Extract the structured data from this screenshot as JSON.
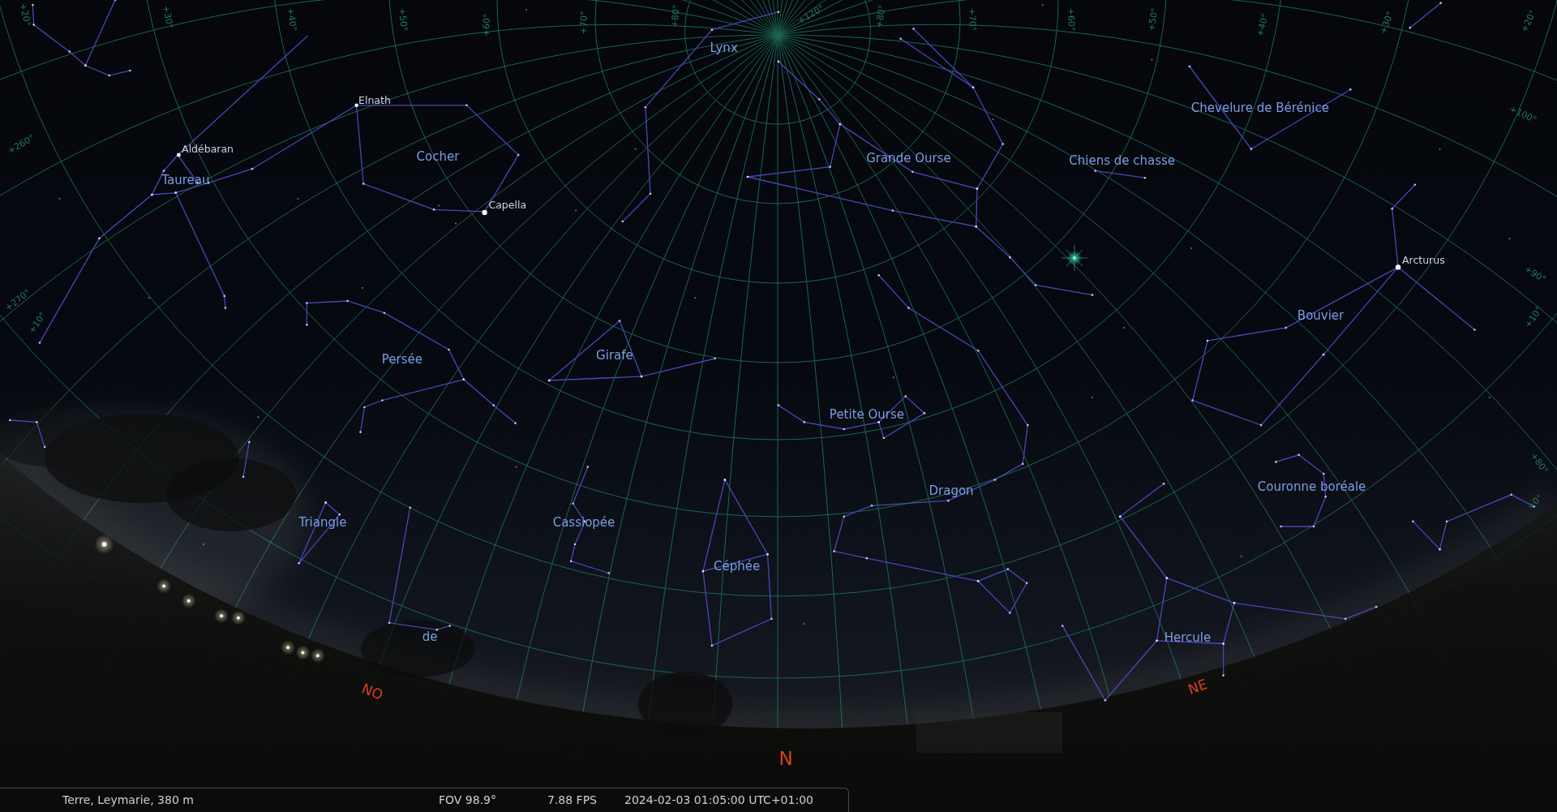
{
  "sky": {
    "grid_labels": [
      "+20°",
      "+30°",
      "+40°",
      "+50°",
      "+60°",
      "+70°",
      "+80°",
      "+120°",
      "+80°",
      "+70°",
      "+60°",
      "+50°",
      "+40°",
      "+30°",
      "+20°",
      "+100°",
      "+260°",
      "+90°",
      "+270°",
      "+10°",
      "+10°",
      "+80°",
      "+0°"
    ],
    "constellations": [
      "Lynx",
      "Chevelure de Bérénice",
      "Cocher",
      "Grande Ourse",
      "Chiens de chasse",
      "Taureau",
      "Bouvier",
      "Girafe",
      "Persée",
      "Petite Ourse",
      "Couronne boréale",
      "Dragon",
      "Triangle",
      "Cassiopée",
      "Céphée",
      "de",
      "Hercule"
    ],
    "stars": [
      "Elnath",
      "Aldébaran",
      "Capella",
      "Arcturus"
    ],
    "cardinal_points": [
      "NO",
      "N",
      "NE"
    ]
  },
  "status_bar": {
    "location": "Terre, Leymarie, 380 m",
    "fov": "FOV 98.9°",
    "fps": "7.88 FPS",
    "datetime": "2024-02-03 01:05:00 UTC+01:00"
  }
}
